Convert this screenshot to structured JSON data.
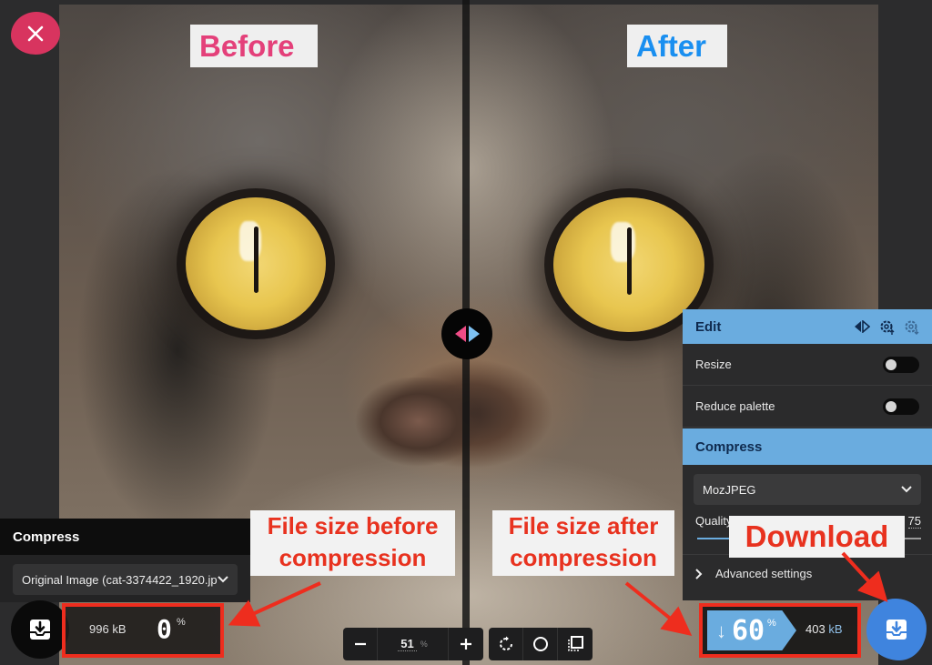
{
  "comparison": {
    "before_label": "Before",
    "after_label": "After",
    "close_icon": "close-icon",
    "divider_icon": "split-arrows-icon"
  },
  "edit_panel": {
    "title": "Edit",
    "header_icons": [
      "split-view-icon",
      "settings-upload-icon",
      "settings-download-icon"
    ],
    "options": [
      {
        "label": "Resize",
        "enabled": false
      },
      {
        "label": "Reduce palette",
        "enabled": false
      }
    ],
    "compress": {
      "title": "Compress",
      "method": "MozJPEG",
      "quality_label": "Quality",
      "quality_value": "75",
      "quality_fraction": 0.75,
      "advanced_label": "Advanced settings"
    }
  },
  "left_panel": {
    "title": "Compress",
    "selected_option": "Original Image (cat-3374422_1920.jp"
  },
  "before_stats": {
    "size_value": "996",
    "size_unit": "kB",
    "percent": "0",
    "percent_sign": "%"
  },
  "after_stats": {
    "arrow": "↓",
    "percent": "60",
    "percent_sign": "%",
    "size_value": "403",
    "size_unit": "kB"
  },
  "toolbar": {
    "zoom_out": "−",
    "zoom_value": "51",
    "zoom_unit": "%",
    "zoom_in": "+"
  },
  "annotations": {
    "before_line1": "File size before",
    "before_line2": "compression",
    "after_line1": "File size after",
    "after_line2": "compression",
    "download": "Download",
    "color": "#ee2d1e"
  },
  "colors": {
    "accent_blue": "#6aacdf",
    "before_pink": "#e4407a",
    "after_blue": "#1a8ff0",
    "close_red": "#d8345f",
    "download_blue": "#3f84de"
  }
}
